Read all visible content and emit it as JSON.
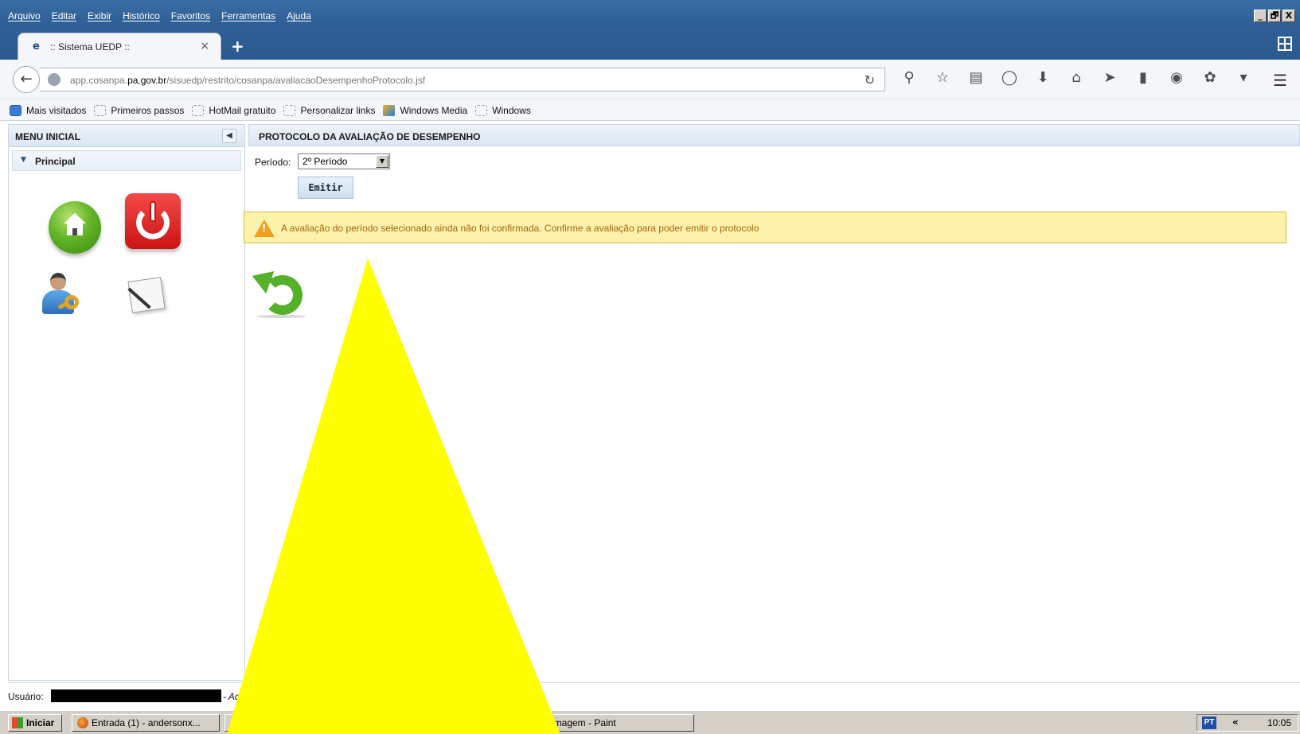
{
  "menu": [
    "Arquivo",
    "Editar",
    "Exibir",
    "Histórico",
    "Favoritos",
    "Ferramentas",
    "Ajuda"
  ],
  "window_controls": [
    "_",
    "🗗",
    "X"
  ],
  "tab": {
    "title": ":: Sistema UEDP ::",
    "close": "×",
    "new": "+"
  },
  "url": {
    "prefix": "app.cosanpa.",
    "domain": "pa.gov.br",
    "path": "/sisuedp/restrito/cosanpa/avaliacaoDesempenhoProtocolo.jsf"
  },
  "nav_icons": [
    "search-icon",
    "star-icon",
    "reading-list-icon",
    "pocket-icon",
    "download-icon",
    "home-icon",
    "send-icon",
    "bookmark-icon",
    "chat-icon",
    "extension-icon",
    "overflow-icon"
  ],
  "bookmarks": [
    "Mais visitados",
    "Primeiros passos",
    "HotMail gratuito",
    "Personalizar links",
    "Windows Media",
    "Windows"
  ],
  "left_menu": {
    "title": "MENU INICIAL",
    "section": "Principal"
  },
  "main": {
    "title": "PROTOCOLO DA AVALIAÇÃO DE DESEMPENHO",
    "period_label": "Período:",
    "period_value": "2º Período",
    "emit_button": "Emitir",
    "warning": "A avaliação do período selecionado ainda não foi confirmada. Confirme a avaliação para poder emitir o protocolo"
  },
  "user_line": {
    "label": "Usuário:",
    "extra": "- Ac"
  },
  "taskbar": {
    "start": "Iniciar",
    "items": [
      "Entrada (1) - andersonx...",
      "imagem - Paint"
    ],
    "lang": "PT",
    "clock": "10:05"
  },
  "colors": {
    "overlay_triangle": "#ffff00",
    "warning_bg": "#fcf2ac",
    "warning_text": "#a8640a"
  }
}
